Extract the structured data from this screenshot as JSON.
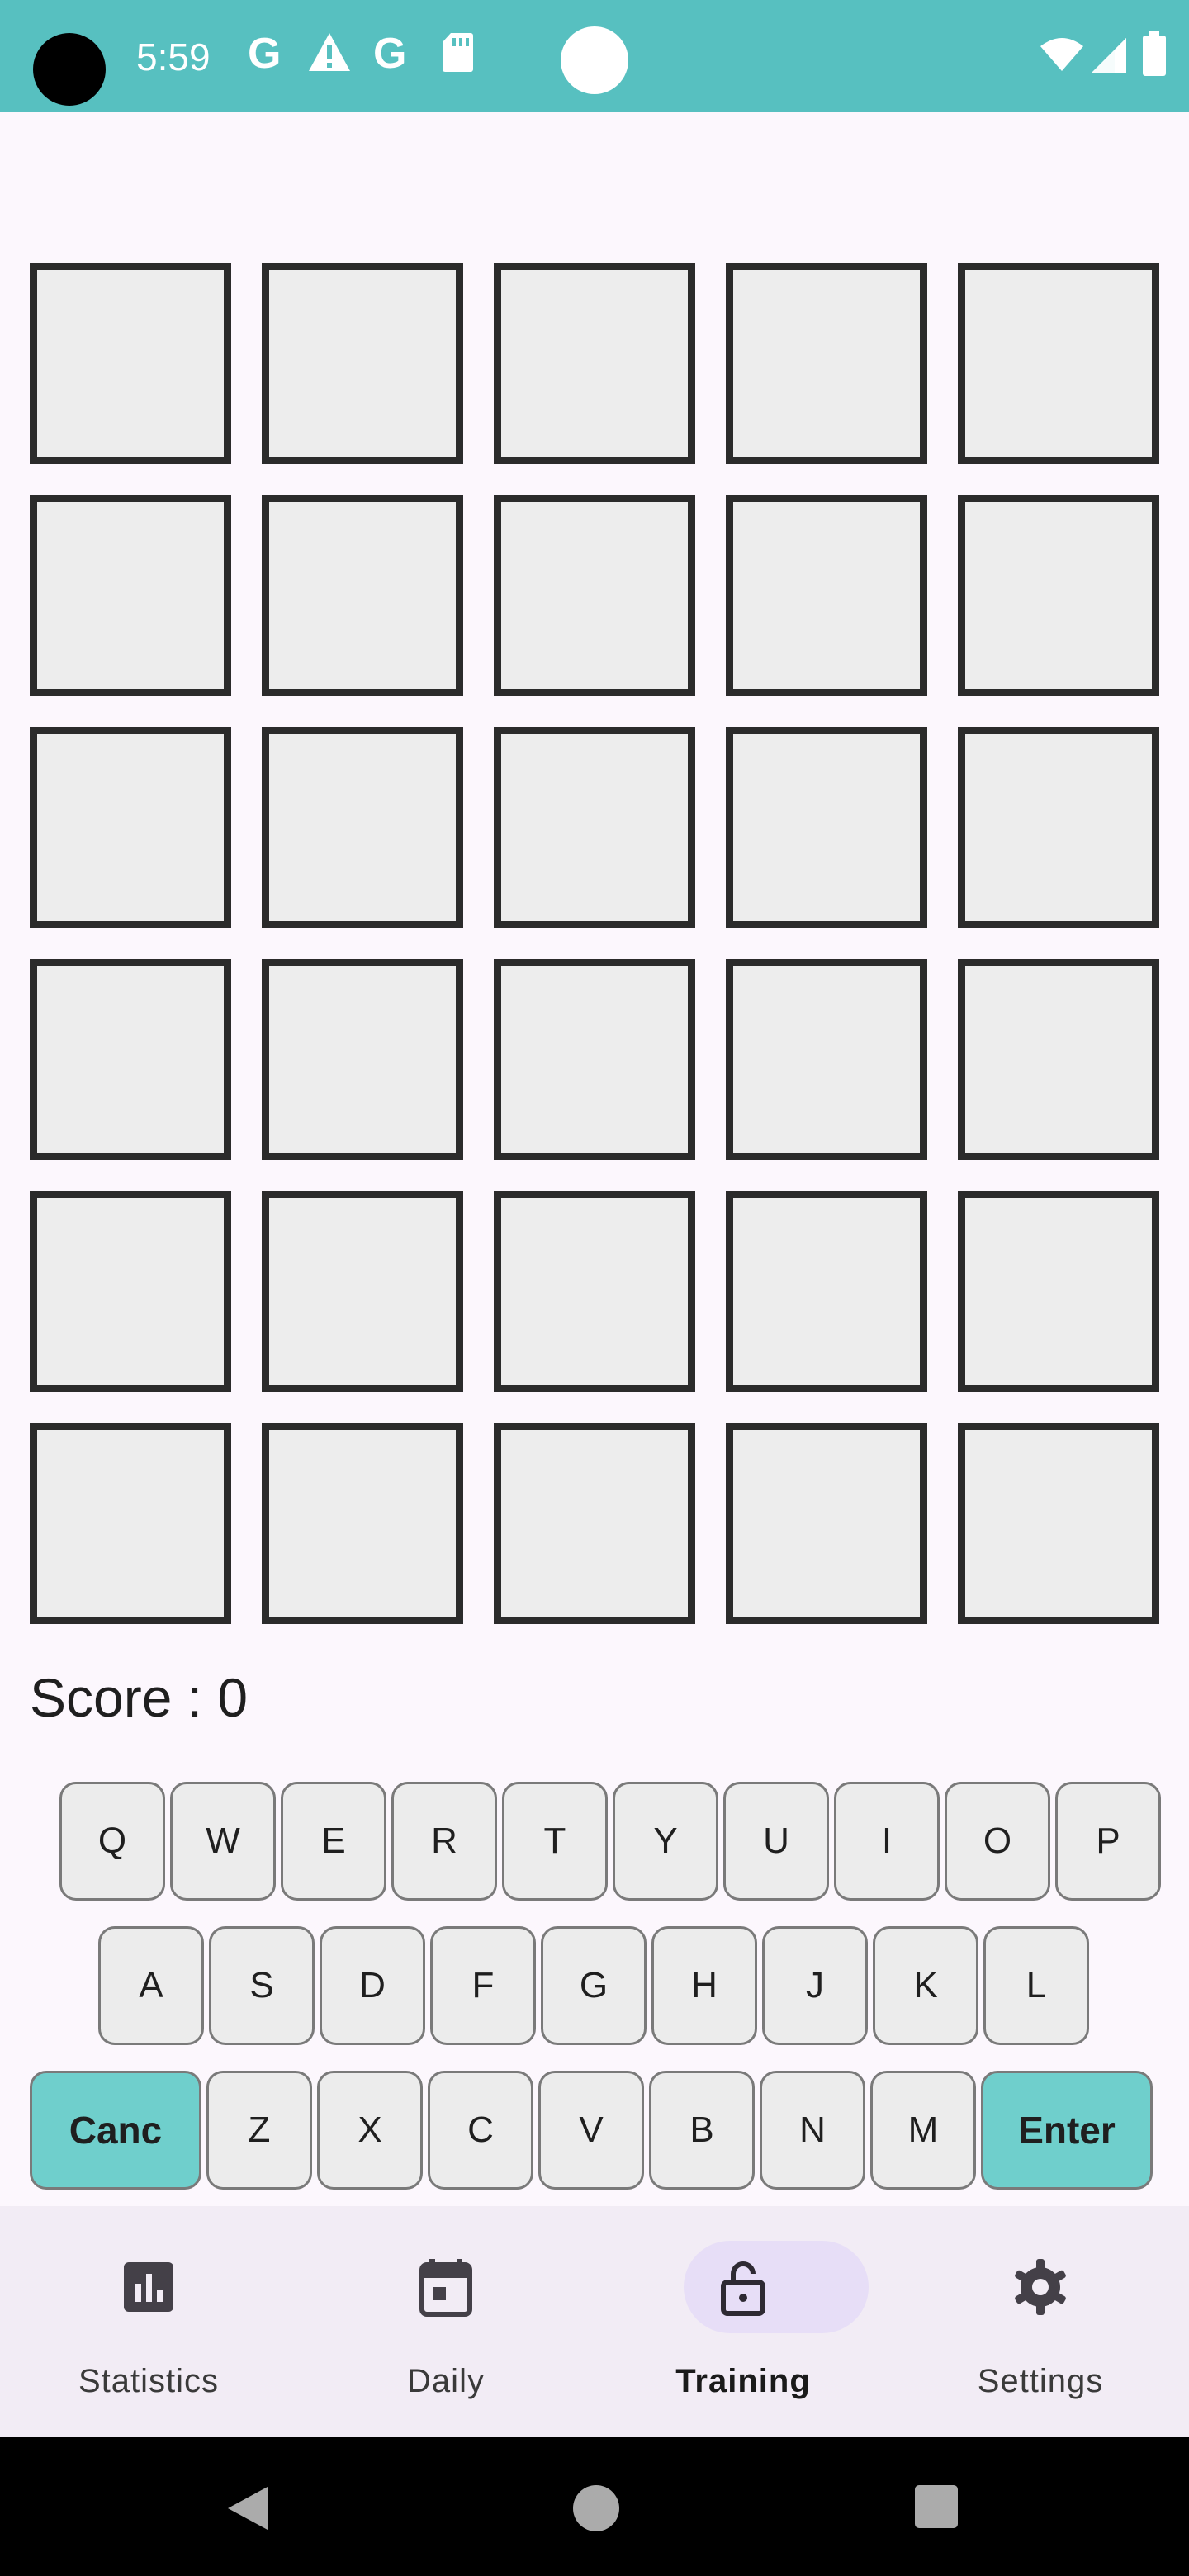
{
  "status_bar": {
    "time": "5:59",
    "notification_icons": [
      "google-icon",
      "warning-icon",
      "google-icon",
      "sd-card-icon"
    ],
    "system_icons": [
      "wifi-icon",
      "signal-icon",
      "battery-icon"
    ],
    "background": "#57c0c0"
  },
  "board": {
    "rows": 6,
    "cols": 5,
    "tiles": [
      [
        "",
        "",
        "",
        "",
        ""
      ],
      [
        "",
        "",
        "",
        "",
        ""
      ],
      [
        "",
        "",
        "",
        "",
        ""
      ],
      [
        "",
        "",
        "",
        "",
        ""
      ],
      [
        "",
        "",
        "",
        "",
        ""
      ],
      [
        "",
        "",
        "",
        "",
        ""
      ]
    ]
  },
  "score": {
    "text": "Score : 0"
  },
  "keyboard": {
    "row1": [
      "Q",
      "W",
      "E",
      "R",
      "T",
      "Y",
      "U",
      "I",
      "O",
      "P"
    ],
    "row2": [
      "A",
      "S",
      "D",
      "F",
      "G",
      "H",
      "J",
      "K",
      "L"
    ],
    "row3": [
      "Z",
      "X",
      "C",
      "V",
      "B",
      "N",
      "M"
    ],
    "cancel_label": "Canc",
    "enter_label": "Enter",
    "action_color": "#6fcfcc"
  },
  "bottom_nav": {
    "items": [
      {
        "label": "Statistics",
        "icon": "bar-chart-icon",
        "active": false
      },
      {
        "label": "Daily",
        "icon": "calendar-icon",
        "active": false
      },
      {
        "label": "Training",
        "icon": "unlock-icon",
        "active": true
      },
      {
        "label": "Settings",
        "icon": "gear-icon",
        "active": false
      }
    ],
    "active_indicator_color": "#e7def7"
  },
  "system_nav": {
    "buttons": [
      "back-icon",
      "home-icon",
      "recents-icon"
    ]
  }
}
